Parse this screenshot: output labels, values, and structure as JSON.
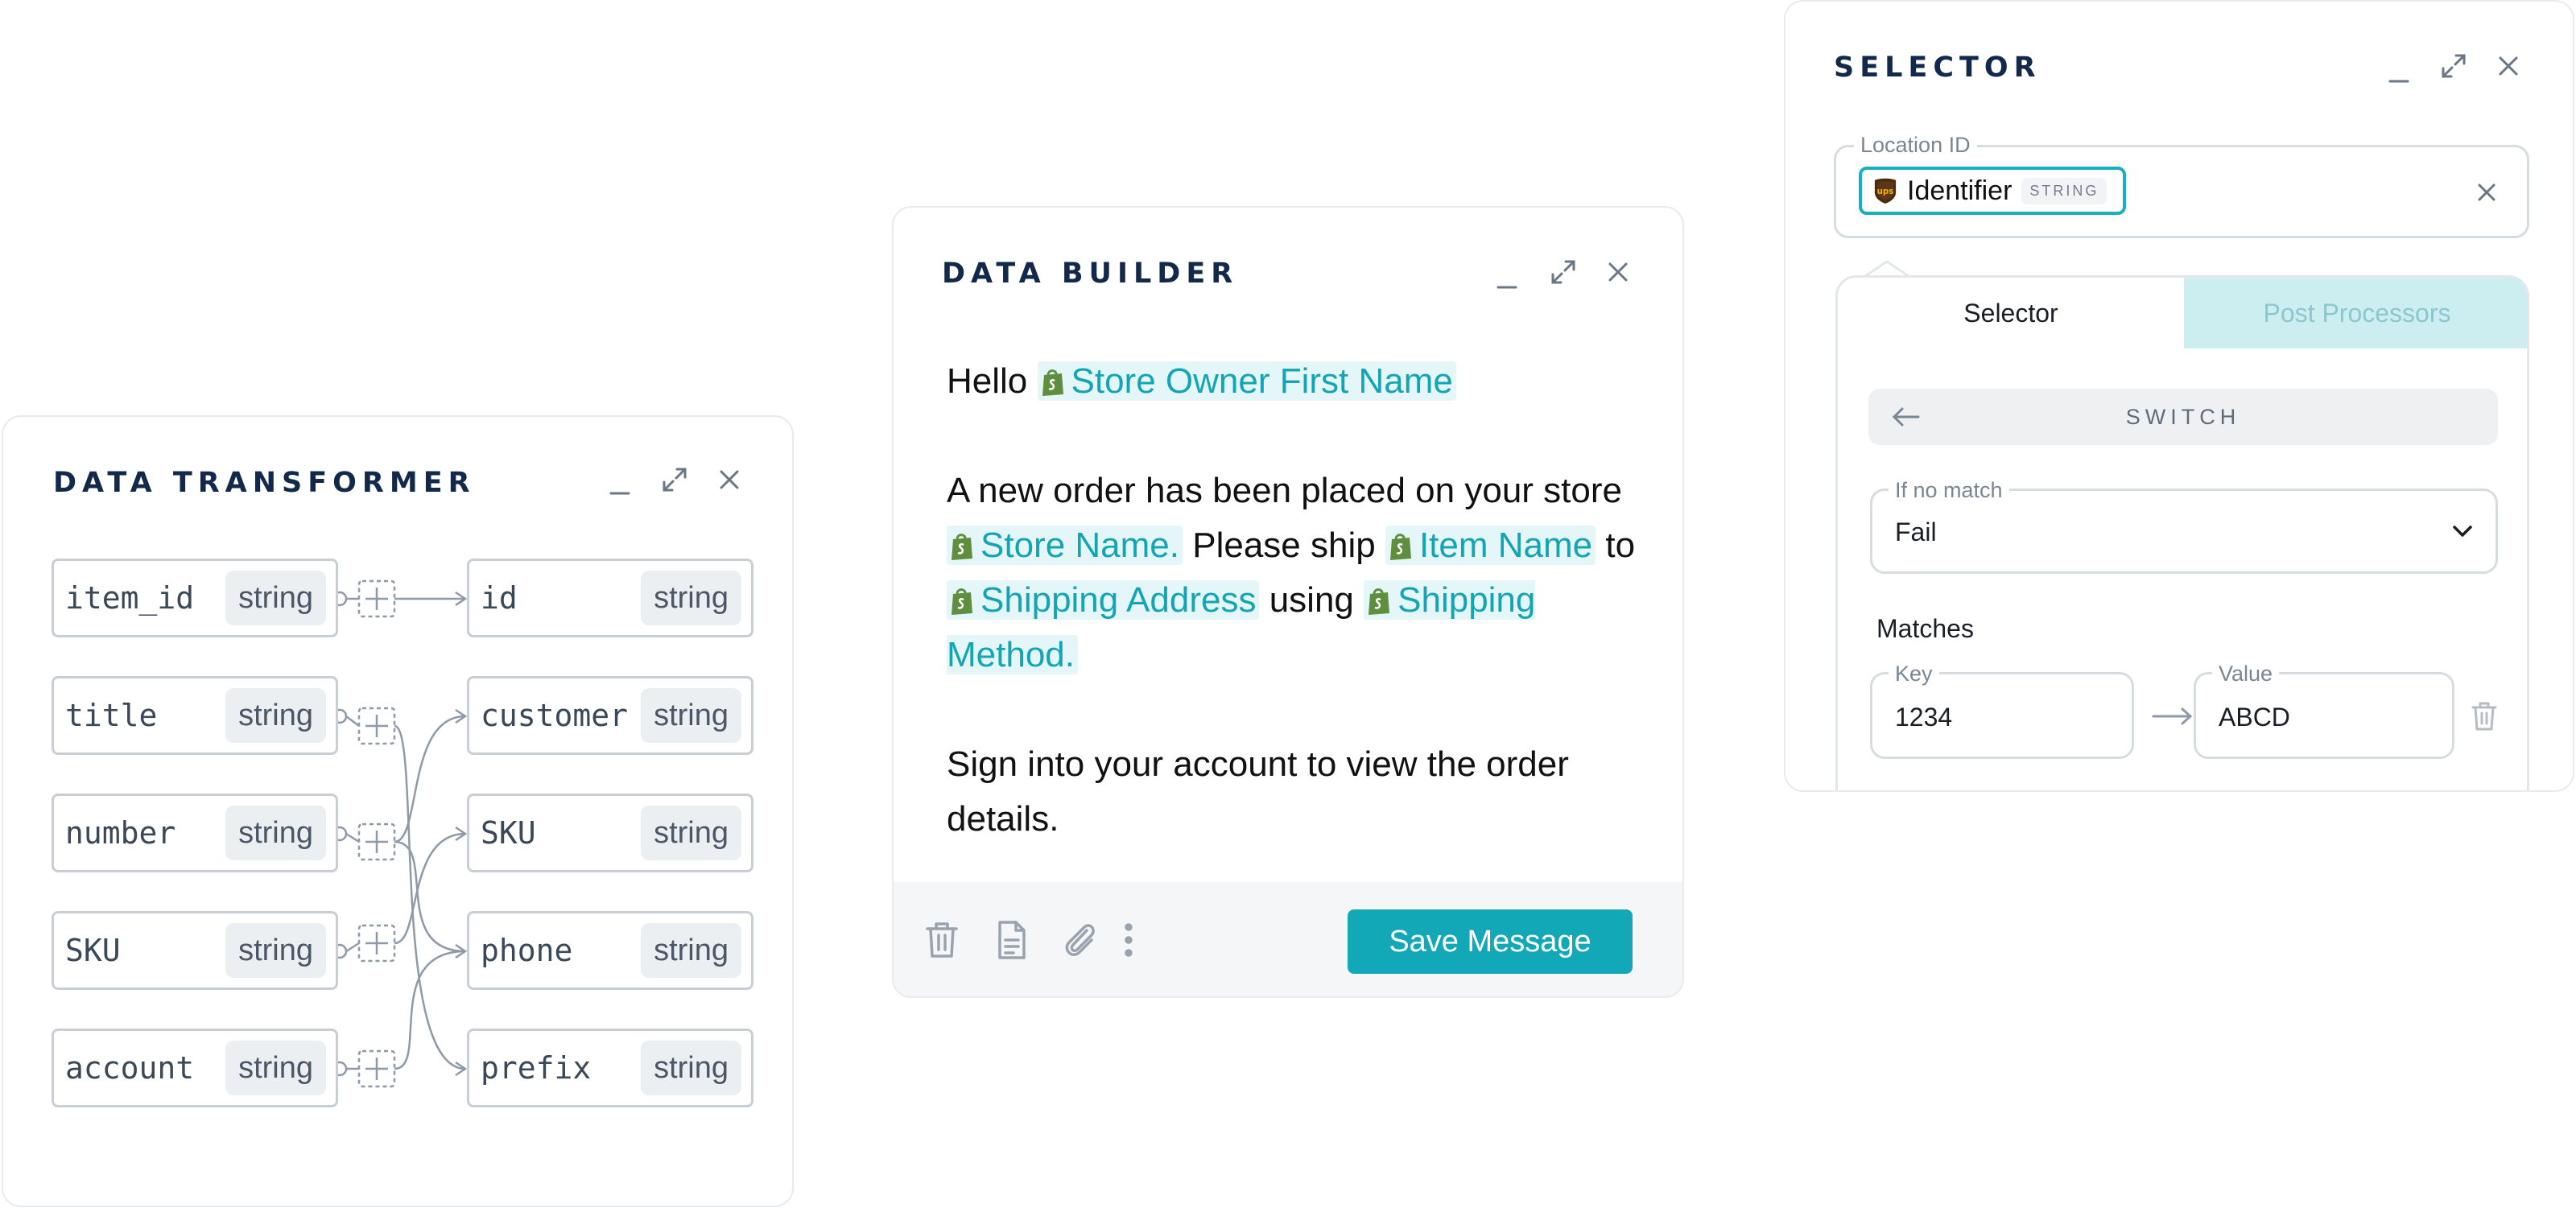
{
  "window_controls": {
    "minimize": "_",
    "expand": "⤢",
    "close": "✕"
  },
  "transformer": {
    "title": "DATA TRANSFORMER",
    "left_fields": [
      {
        "name": "item_id",
        "type": "string"
      },
      {
        "name": "title",
        "type": "string"
      },
      {
        "name": "number",
        "type": "string"
      },
      {
        "name": "SKU",
        "type": "string"
      },
      {
        "name": "account",
        "type": "string"
      }
    ],
    "right_fields": [
      {
        "name": "id",
        "type": "string"
      },
      {
        "name": "customer",
        "type": "string"
      },
      {
        "name": "SKU",
        "type": "string"
      },
      {
        "name": "phone",
        "type": "string"
      },
      {
        "name": "prefix",
        "type": "string"
      }
    ]
  },
  "builder": {
    "title": "DATA BUILDER",
    "p1_text_1": "Hello",
    "var_store_owner": "Store Owner First Name",
    "p2_text_1": "A new order has been placed on your store",
    "var_store_name": "Store Name.",
    "p2_text_2": "Please ship",
    "var_item_name": "Item Name",
    "p2_text_3": "to",
    "var_shipping_address": "Shipping Address",
    "p2_text_4": "using",
    "var_shipping_method": "Shipping Method.",
    "p3_text": "Sign into your account to view the order details.",
    "save_label": "Save Message",
    "icons": [
      "trash-icon",
      "document-icon",
      "paperclip-icon",
      "more-vertical-icon"
    ],
    "accent_color": "#12a8b8"
  },
  "selector": {
    "title": "SELECTOR",
    "location_label": "Location ID",
    "chip_label": "Identifier",
    "chip_type": "STRING",
    "chip_logo": "ups",
    "tabs": {
      "active": "Selector",
      "inactive": "Post Processors"
    },
    "switch_label": "SWITCH",
    "no_match_label": "If no match",
    "no_match_value": "Fail",
    "matches_label": "Matches",
    "key_label": "Key",
    "key_value": "1234",
    "value_label": "Value",
    "value_value": "ABCD"
  }
}
